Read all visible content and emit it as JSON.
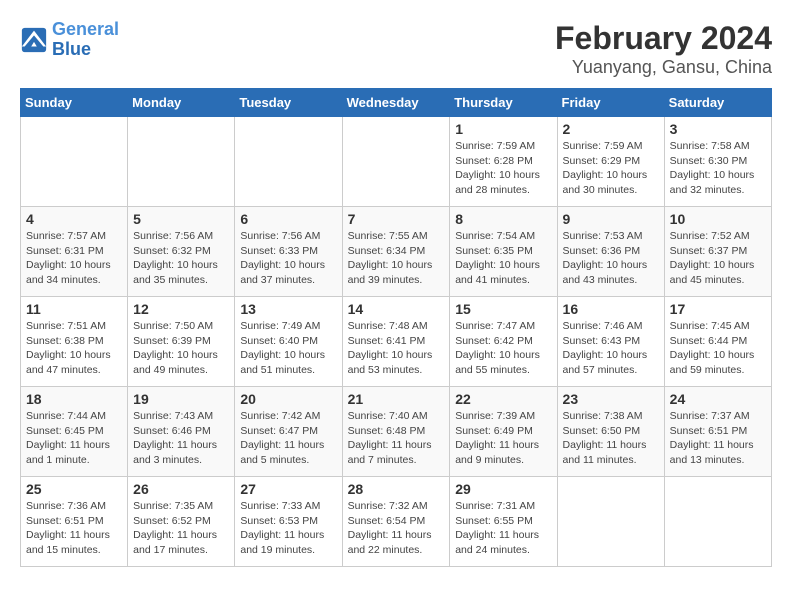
{
  "logo": {
    "text_general": "General",
    "text_blue": "Blue"
  },
  "title": "February 2024",
  "subtitle": "Yuanyang, Gansu, China",
  "days_of_week": [
    "Sunday",
    "Monday",
    "Tuesday",
    "Wednesday",
    "Thursday",
    "Friday",
    "Saturday"
  ],
  "weeks": [
    [
      {
        "day": "",
        "info": ""
      },
      {
        "day": "",
        "info": ""
      },
      {
        "day": "",
        "info": ""
      },
      {
        "day": "",
        "info": ""
      },
      {
        "day": "1",
        "info": "Sunrise: 7:59 AM\nSunset: 6:28 PM\nDaylight: 10 hours\nand 28 minutes."
      },
      {
        "day": "2",
        "info": "Sunrise: 7:59 AM\nSunset: 6:29 PM\nDaylight: 10 hours\nand 30 minutes."
      },
      {
        "day": "3",
        "info": "Sunrise: 7:58 AM\nSunset: 6:30 PM\nDaylight: 10 hours\nand 32 minutes."
      }
    ],
    [
      {
        "day": "4",
        "info": "Sunrise: 7:57 AM\nSunset: 6:31 PM\nDaylight: 10 hours\nand 34 minutes."
      },
      {
        "day": "5",
        "info": "Sunrise: 7:56 AM\nSunset: 6:32 PM\nDaylight: 10 hours\nand 35 minutes."
      },
      {
        "day": "6",
        "info": "Sunrise: 7:56 AM\nSunset: 6:33 PM\nDaylight: 10 hours\nand 37 minutes."
      },
      {
        "day": "7",
        "info": "Sunrise: 7:55 AM\nSunset: 6:34 PM\nDaylight: 10 hours\nand 39 minutes."
      },
      {
        "day": "8",
        "info": "Sunrise: 7:54 AM\nSunset: 6:35 PM\nDaylight: 10 hours\nand 41 minutes."
      },
      {
        "day": "9",
        "info": "Sunrise: 7:53 AM\nSunset: 6:36 PM\nDaylight: 10 hours\nand 43 minutes."
      },
      {
        "day": "10",
        "info": "Sunrise: 7:52 AM\nSunset: 6:37 PM\nDaylight: 10 hours\nand 45 minutes."
      }
    ],
    [
      {
        "day": "11",
        "info": "Sunrise: 7:51 AM\nSunset: 6:38 PM\nDaylight: 10 hours\nand 47 minutes."
      },
      {
        "day": "12",
        "info": "Sunrise: 7:50 AM\nSunset: 6:39 PM\nDaylight: 10 hours\nand 49 minutes."
      },
      {
        "day": "13",
        "info": "Sunrise: 7:49 AM\nSunset: 6:40 PM\nDaylight: 10 hours\nand 51 minutes."
      },
      {
        "day": "14",
        "info": "Sunrise: 7:48 AM\nSunset: 6:41 PM\nDaylight: 10 hours\nand 53 minutes."
      },
      {
        "day": "15",
        "info": "Sunrise: 7:47 AM\nSunset: 6:42 PM\nDaylight: 10 hours\nand 55 minutes."
      },
      {
        "day": "16",
        "info": "Sunrise: 7:46 AM\nSunset: 6:43 PM\nDaylight: 10 hours\nand 57 minutes."
      },
      {
        "day": "17",
        "info": "Sunrise: 7:45 AM\nSunset: 6:44 PM\nDaylight: 10 hours\nand 59 minutes."
      }
    ],
    [
      {
        "day": "18",
        "info": "Sunrise: 7:44 AM\nSunset: 6:45 PM\nDaylight: 11 hours\nand 1 minute."
      },
      {
        "day": "19",
        "info": "Sunrise: 7:43 AM\nSunset: 6:46 PM\nDaylight: 11 hours\nand 3 minutes."
      },
      {
        "day": "20",
        "info": "Sunrise: 7:42 AM\nSunset: 6:47 PM\nDaylight: 11 hours\nand 5 minutes."
      },
      {
        "day": "21",
        "info": "Sunrise: 7:40 AM\nSunset: 6:48 PM\nDaylight: 11 hours\nand 7 minutes."
      },
      {
        "day": "22",
        "info": "Sunrise: 7:39 AM\nSunset: 6:49 PM\nDaylight: 11 hours\nand 9 minutes."
      },
      {
        "day": "23",
        "info": "Sunrise: 7:38 AM\nSunset: 6:50 PM\nDaylight: 11 hours\nand 11 minutes."
      },
      {
        "day": "24",
        "info": "Sunrise: 7:37 AM\nSunset: 6:51 PM\nDaylight: 11 hours\nand 13 minutes."
      }
    ],
    [
      {
        "day": "25",
        "info": "Sunrise: 7:36 AM\nSunset: 6:51 PM\nDaylight: 11 hours\nand 15 minutes."
      },
      {
        "day": "26",
        "info": "Sunrise: 7:35 AM\nSunset: 6:52 PM\nDaylight: 11 hours\nand 17 minutes."
      },
      {
        "day": "27",
        "info": "Sunrise: 7:33 AM\nSunset: 6:53 PM\nDaylight: 11 hours\nand 19 minutes."
      },
      {
        "day": "28",
        "info": "Sunrise: 7:32 AM\nSunset: 6:54 PM\nDaylight: 11 hours\nand 22 minutes."
      },
      {
        "day": "29",
        "info": "Sunrise: 7:31 AM\nSunset: 6:55 PM\nDaylight: 11 hours\nand 24 minutes."
      },
      {
        "day": "",
        "info": ""
      },
      {
        "day": "",
        "info": ""
      }
    ]
  ]
}
